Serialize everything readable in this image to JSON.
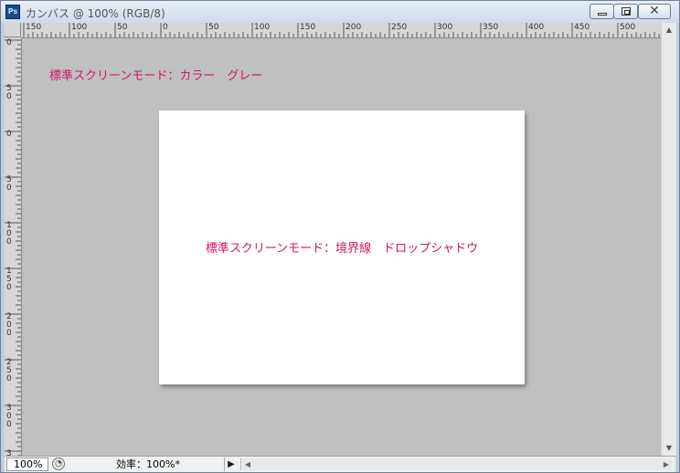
{
  "window": {
    "app_icon_text": "Ps",
    "title": "カンバス @ 100% (RGB/8)",
    "buttons": {
      "minimize": "minimize",
      "maximize": "restore",
      "close": "✕"
    }
  },
  "rulers": {
    "horizontal": [
      "150",
      "100",
      "50",
      "0",
      "50",
      "100",
      "150",
      "200",
      "250",
      "300",
      "350",
      "400",
      "450",
      "500"
    ],
    "vertical": [
      [
        "0"
      ],
      [
        "5",
        "0"
      ],
      [
        "0"
      ],
      [
        "5",
        "0"
      ],
      [
        "1",
        "0",
        "0"
      ],
      [
        "1",
        "5",
        "0"
      ],
      [
        "2",
        "0",
        "0"
      ],
      [
        "2",
        "5",
        "0"
      ],
      [
        "3",
        "0",
        "0"
      ],
      [
        "3",
        "5"
      ]
    ]
  },
  "canvas": {
    "gray_area_label": "標準スクリーンモード：カラー　グレー",
    "document_label": "標準スクリーンモード：境界線　ドロップシャドウ"
  },
  "status": {
    "zoom": "100%",
    "info": "効率：100%*",
    "menu_arrow": "▶"
  },
  "icons": {
    "app": "photoshop-icon",
    "zoom_tool": "zoom-options-icon",
    "scroll_left": "scroll-left-arrow",
    "scroll_right": "scroll-right-arrow",
    "scroll_up": "scroll-up-arrow",
    "scroll_down": "scroll-down-arrow"
  },
  "colors": {
    "label_text": "#d21469",
    "pasteboard": "#c0c0c0",
    "document": "#ffffff"
  }
}
